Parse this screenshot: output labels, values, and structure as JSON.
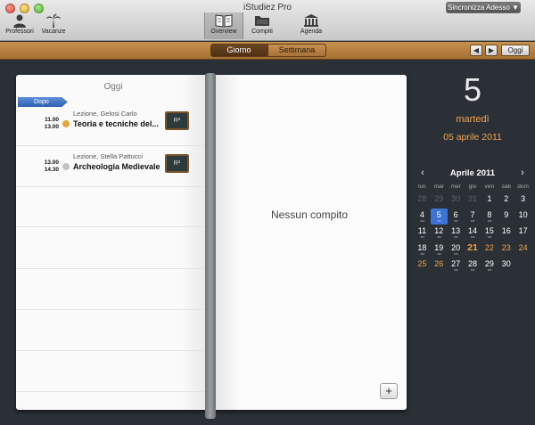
{
  "window": {
    "title": "iStudiez Pro",
    "sync_button": "Sincronizza Adesso ▼"
  },
  "toolbar": {
    "items": [
      {
        "label": "Professori",
        "icon": "person-icon"
      },
      {
        "label": "Vacanze",
        "icon": "palm-tree-icon"
      },
      {
        "label": "Overview",
        "icon": "open-book-icon"
      },
      {
        "label": "Compiti",
        "icon": "folder-icon"
      },
      {
        "label": "Agenda",
        "icon": "building-icon"
      }
    ],
    "active": "Overview"
  },
  "views": {
    "day": "Giorno",
    "week": "Settimana",
    "prev": "◀",
    "next": "▶",
    "today": "Oggi"
  },
  "schedule": {
    "header": "Oggi",
    "badge": "Dopo",
    "lessons": [
      {
        "start": "11.00",
        "end": "13.00",
        "type": "Lezione, Gelosi Carlo",
        "subject": "Teoria e tecniche del...",
        "dot_color": "#e4a63b",
        "board": "R²"
      },
      {
        "start": "13.00",
        "end": "14.30",
        "type": "Lezione, Stella Pattucci",
        "subject": "Archeologia Medievale",
        "dot_color": "#c3c3c3",
        "board": "R²"
      }
    ]
  },
  "tasks": {
    "empty_text": "Nessun compito",
    "add": "+"
  },
  "date": {
    "day": "5",
    "weekday": "martedì",
    "full": "05 aprile 2011"
  },
  "calendar": {
    "title": "Aprile 2011",
    "prev": "‹",
    "next": "›",
    "weekdays": [
      "lun",
      "mar",
      "mer",
      "gio",
      "ven",
      "sab",
      "dom"
    ],
    "days": [
      {
        "d": "28",
        "other": true
      },
      {
        "d": "29",
        "other": true
      },
      {
        "d": "30",
        "other": true
      },
      {
        "d": "31",
        "other": true
      },
      {
        "d": "1"
      },
      {
        "d": "2"
      },
      {
        "d": "3"
      },
      {
        "d": "4",
        "dots": true
      },
      {
        "d": "5",
        "dots": true,
        "selected": true
      },
      {
        "d": "6",
        "dots": true
      },
      {
        "d": "7",
        "dots": true
      },
      {
        "d": "8",
        "dots": true
      },
      {
        "d": "9"
      },
      {
        "d": "10"
      },
      {
        "d": "11",
        "dots": true
      },
      {
        "d": "12",
        "dots": true
      },
      {
        "d": "13",
        "dots": true
      },
      {
        "d": "14",
        "dots": true
      },
      {
        "d": "15",
        "dots": true
      },
      {
        "d": "16"
      },
      {
        "d": "17"
      },
      {
        "d": "18",
        "dots": true
      },
      {
        "d": "19",
        "dots": true
      },
      {
        "d": "20",
        "dots": true
      },
      {
        "d": "21",
        "bold": true
      },
      {
        "d": "22",
        "orange": true
      },
      {
        "d": "23",
        "orange": true
      },
      {
        "d": "24",
        "orange": true
      },
      {
        "d": "25",
        "orange": true
      },
      {
        "d": "26",
        "orange": true
      },
      {
        "d": "27",
        "dots": true
      },
      {
        "d": "28",
        "dots": true
      },
      {
        "d": "29",
        "dots": true
      },
      {
        "d": "30"
      }
    ]
  }
}
